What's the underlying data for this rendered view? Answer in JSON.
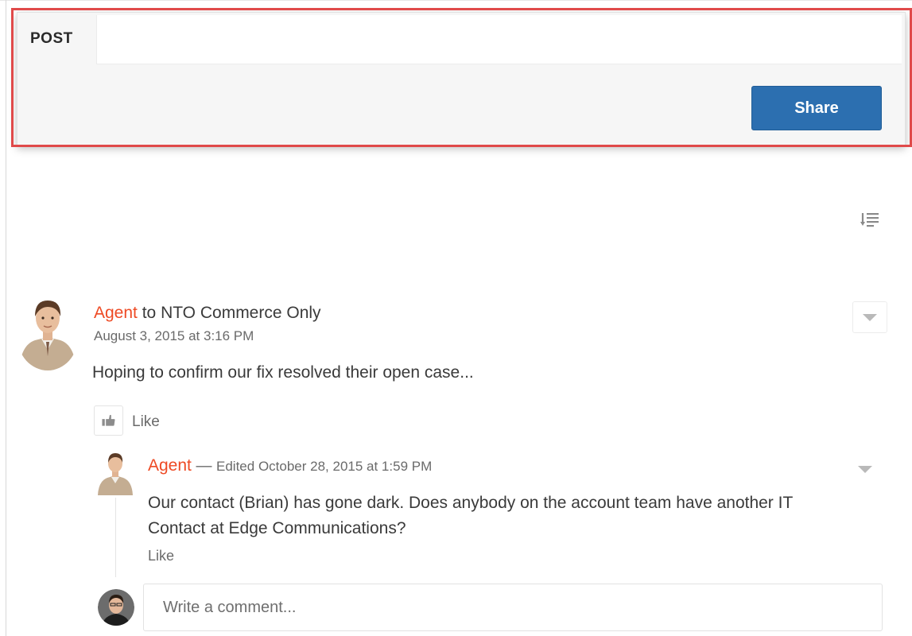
{
  "publisher": {
    "tab_label": "POST",
    "share_label": "Share"
  },
  "feed": {
    "sort_icon": "sort-icon",
    "post": {
      "author": "Agent",
      "target_text": " to NTO Commerce Only",
      "timestamp": "August 3, 2015 at 3:16 PM",
      "body": "Hoping to confirm our fix resolved their open case...",
      "like_label": "Like",
      "like_icon": "thumbs-up-icon"
    },
    "comment": {
      "author": "Agent",
      "separator": " — ",
      "edited_text": "Edited October 28, 2015 at 1:59 PM",
      "body": "Our contact (Brian) has gone dark. Does anybody on the account team have another IT Contact at Edge Communications?",
      "like_label": "Like"
    },
    "comment_input": {
      "placeholder": "Write a comment..."
    }
  },
  "colors": {
    "author_link": "#ee4a24",
    "share_button": "#2c6fb0",
    "highlight_frame": "#e04a4a"
  }
}
